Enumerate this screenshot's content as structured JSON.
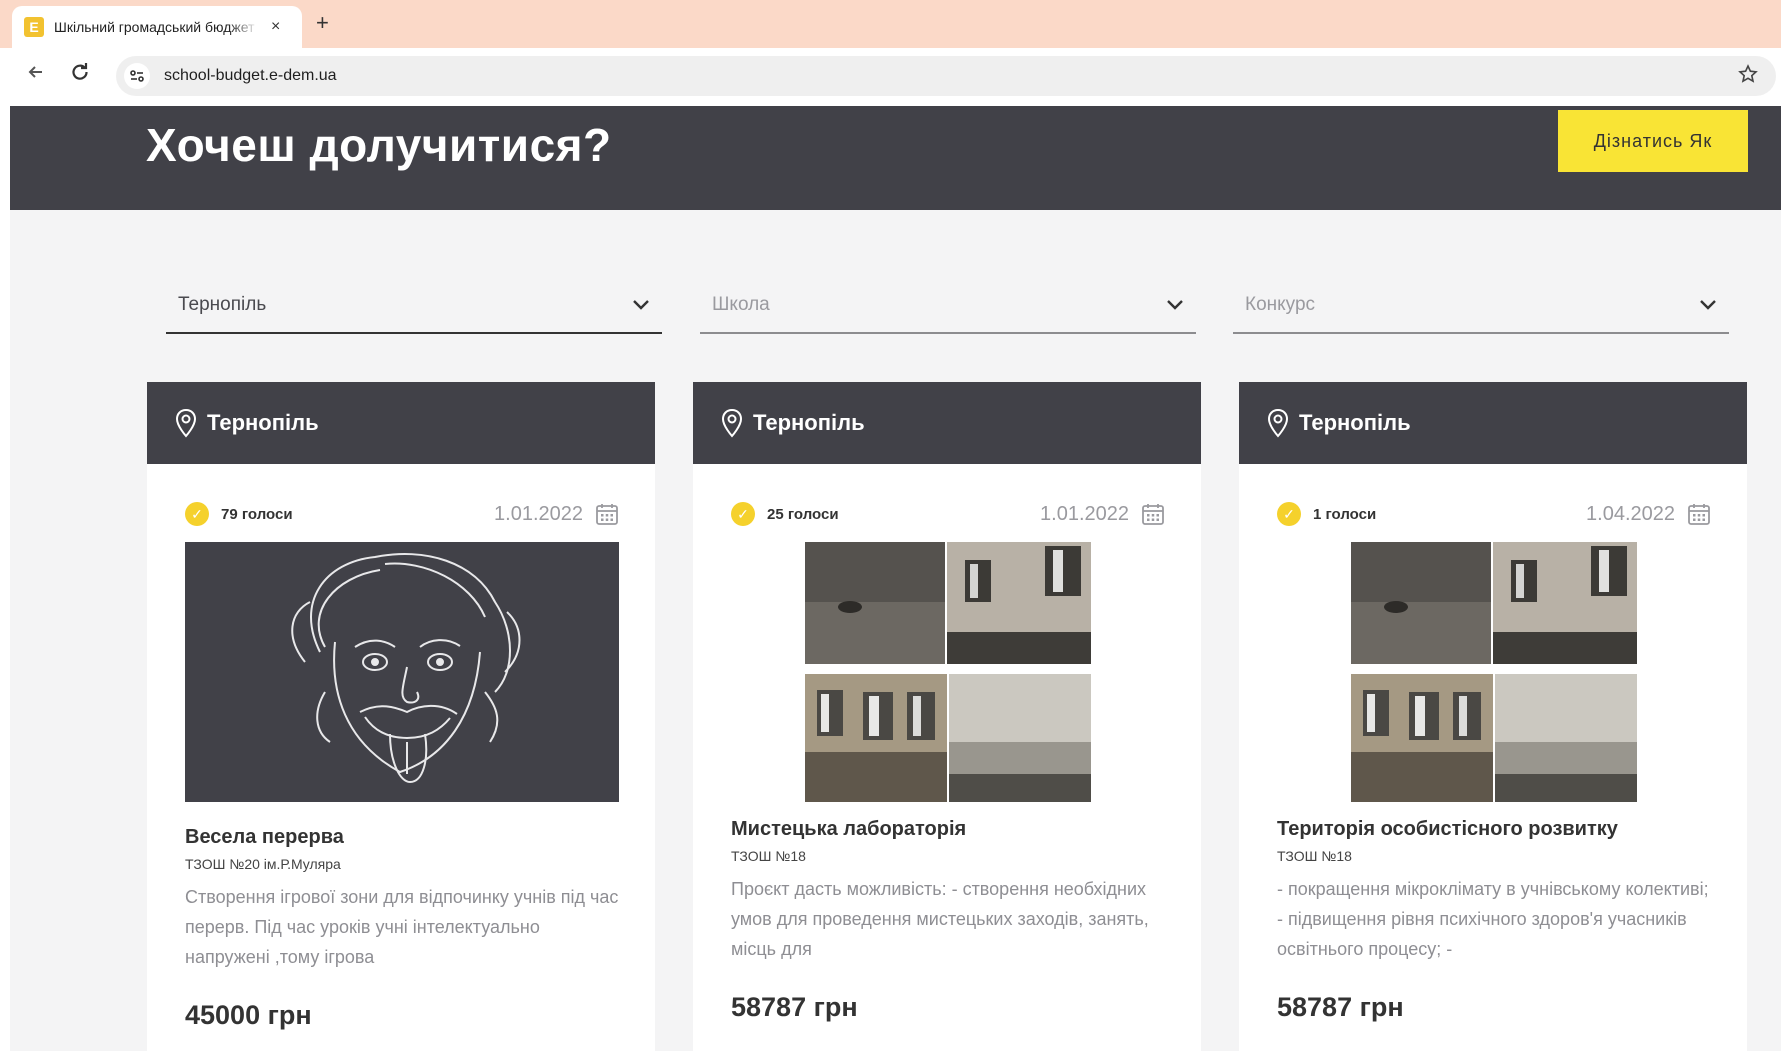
{
  "browser": {
    "tab_title": "Шкільний громадський бюджет",
    "tab_favicon_letter": "E",
    "tab_close": "×",
    "new_tab": "+",
    "url": "school-budget.e-dem.ua",
    "icons": [
      "back-arrow-icon",
      "reload-icon",
      "site-info-icon",
      "bookmark-star-icon"
    ]
  },
  "banner": {
    "title": "Хочеш долучитися?",
    "button_label": "Дізнатись Як",
    "button_color": "#f9e435",
    "background": "#414148"
  },
  "filters": [
    {
      "value": "Тернопіль",
      "active": true
    },
    {
      "placeholder": "Школа",
      "active": false
    },
    {
      "placeholder": "Конкурс",
      "active": false
    }
  ],
  "cards": [
    {
      "city": "Тернопіль",
      "votes": "79 голоси",
      "date": "1.01.2022",
      "image": "einstein-illustration",
      "title": "Весела перерва",
      "school": "ТЗОШ №20 ім.Р.Муляра",
      "description": "Створення ігрової зони для відпочинку учнів під час перерв. Під час уроків учні інтелектуально напружені ,тому ігрова",
      "price": "45000 грн"
    },
    {
      "city": "Тернопіль",
      "votes": "25 голоси",
      "date": "1.01.2022",
      "image": "building-damage-photo",
      "title": "Мистецька лабораторія",
      "school": "ТЗОШ №18",
      "description": "Проєкт дасть можливість: - створення необхідних умов для проведення мистецьких заходів, занять, місць для",
      "price": "58787 грн"
    },
    {
      "city": "Тернопіль",
      "votes": "1 голоси",
      "date": "1.04.2022",
      "image": "building-damage-photo",
      "title": "Територія особистісного розвитку",
      "school": "ТЗОШ №18",
      "description": "- покращення мікроклімату в учнівському колективі; - підвищення рівня психічного здоров'я учасників освітнього процесу; -",
      "price": "58787 грн"
    }
  ],
  "accent_color": "#f5d12c"
}
